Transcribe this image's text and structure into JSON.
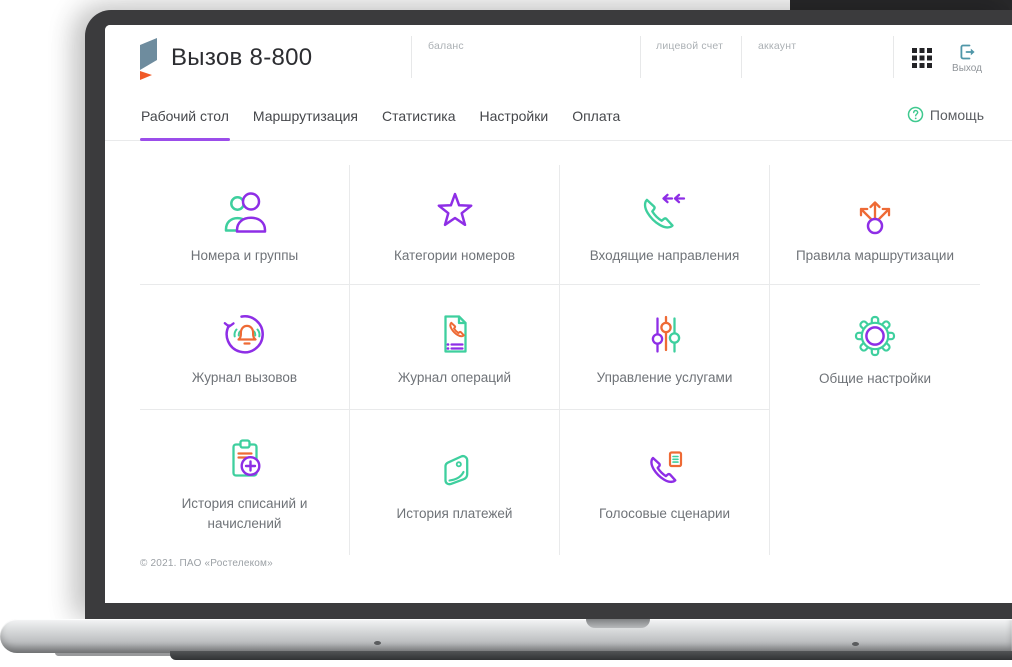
{
  "colors": {
    "accent_purple": "#8e2ee6",
    "accent_teal": "#3ecf9e",
    "accent_orange": "#ee6a35",
    "logo_slate": "#6e8c9e",
    "help_green": "#3fc98f"
  },
  "header": {
    "app_title": "Вызов 8-800",
    "balance_label": "баланс",
    "personal_account_label": "лицевой счет",
    "account_label": "аккаунт",
    "logout_label": "Выход"
  },
  "nav": {
    "tabs": [
      {
        "label": "Рабочий стол",
        "active": true
      },
      {
        "label": "Маршрутизация",
        "active": false
      },
      {
        "label": "Статистика",
        "active": false
      },
      {
        "label": "Настройки",
        "active": false
      },
      {
        "label": "Оплата",
        "active": false
      }
    ],
    "help_label": "Помощь"
  },
  "tiles": [
    {
      "label": "Номера и группы",
      "icon": "users-icon"
    },
    {
      "label": "Категории номеров",
      "icon": "star-icon"
    },
    {
      "label": "Входящие направления",
      "icon": "incoming-call-icon"
    },
    {
      "label": "Правила маршрутизации",
      "icon": "routing-arrows-icon"
    },
    {
      "label": "Журнал вызовов",
      "icon": "call-log-icon"
    },
    {
      "label": "Журнал операций",
      "icon": "operations-log-icon"
    },
    {
      "label": "Управление услугами",
      "icon": "sliders-icon"
    },
    {
      "label": "Общие настройки",
      "icon": "gear-icon"
    },
    {
      "label": "История списаний и начислений",
      "icon": "clipboard-plus-icon"
    },
    {
      "label": "История платежей",
      "icon": "wallet-icon"
    },
    {
      "label": "Голосовые сценарии",
      "icon": "voice-script-icon"
    }
  ],
  "footer": {
    "copyright": "© 2021. ПАО «Ростелеком»"
  }
}
